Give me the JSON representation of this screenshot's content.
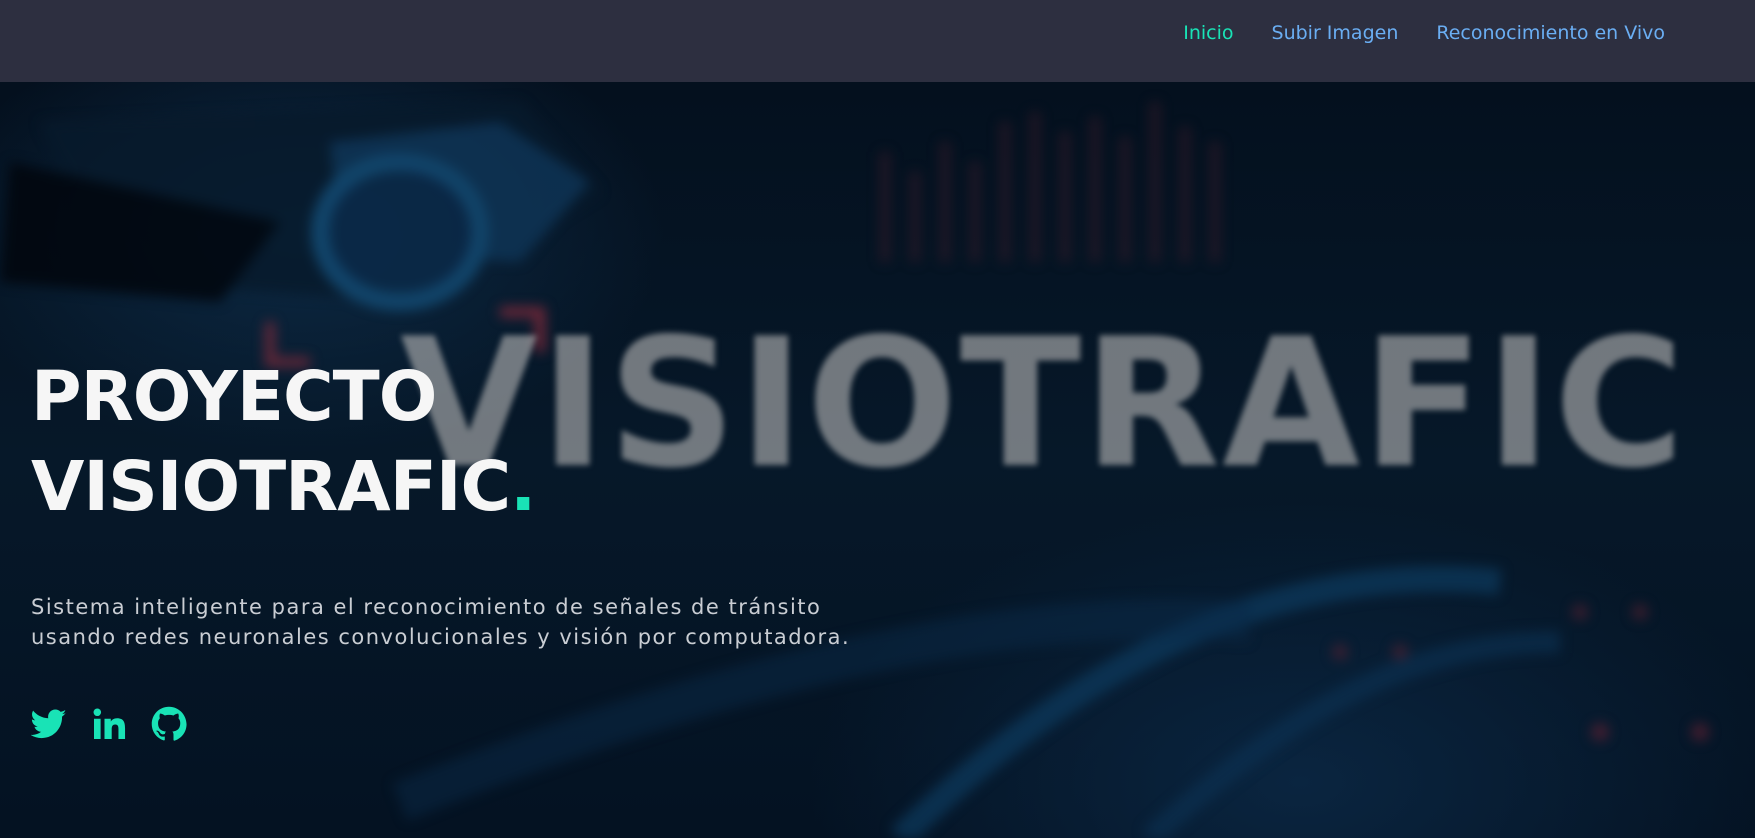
{
  "nav": {
    "links": [
      {
        "label": "Inicio",
        "active": true
      },
      {
        "label": "Subir Imagen",
        "active": false
      },
      {
        "label": "Reconocimiento en Vivo",
        "active": false
      }
    ]
  },
  "hero": {
    "background_word": "VISIOTRAFIC",
    "title_line1": "PROYECTO",
    "title_line2": "VISIOTRAFIC",
    "title_dot": ".",
    "description_line1": "Sistema inteligente para el reconocimiento de señales de tránsito",
    "description_line2": "usando redes neuronales convolucionales y visión por computadora."
  },
  "socials": [
    {
      "icon": "twitter-icon"
    },
    {
      "icon": "linkedin-icon"
    },
    {
      "icon": "github-icon"
    }
  ],
  "colors": {
    "accent": "#19e3b6",
    "nav_link": "#6aaef3",
    "navbar_bg": "#2d2f40",
    "hero_bg": "#061526"
  }
}
